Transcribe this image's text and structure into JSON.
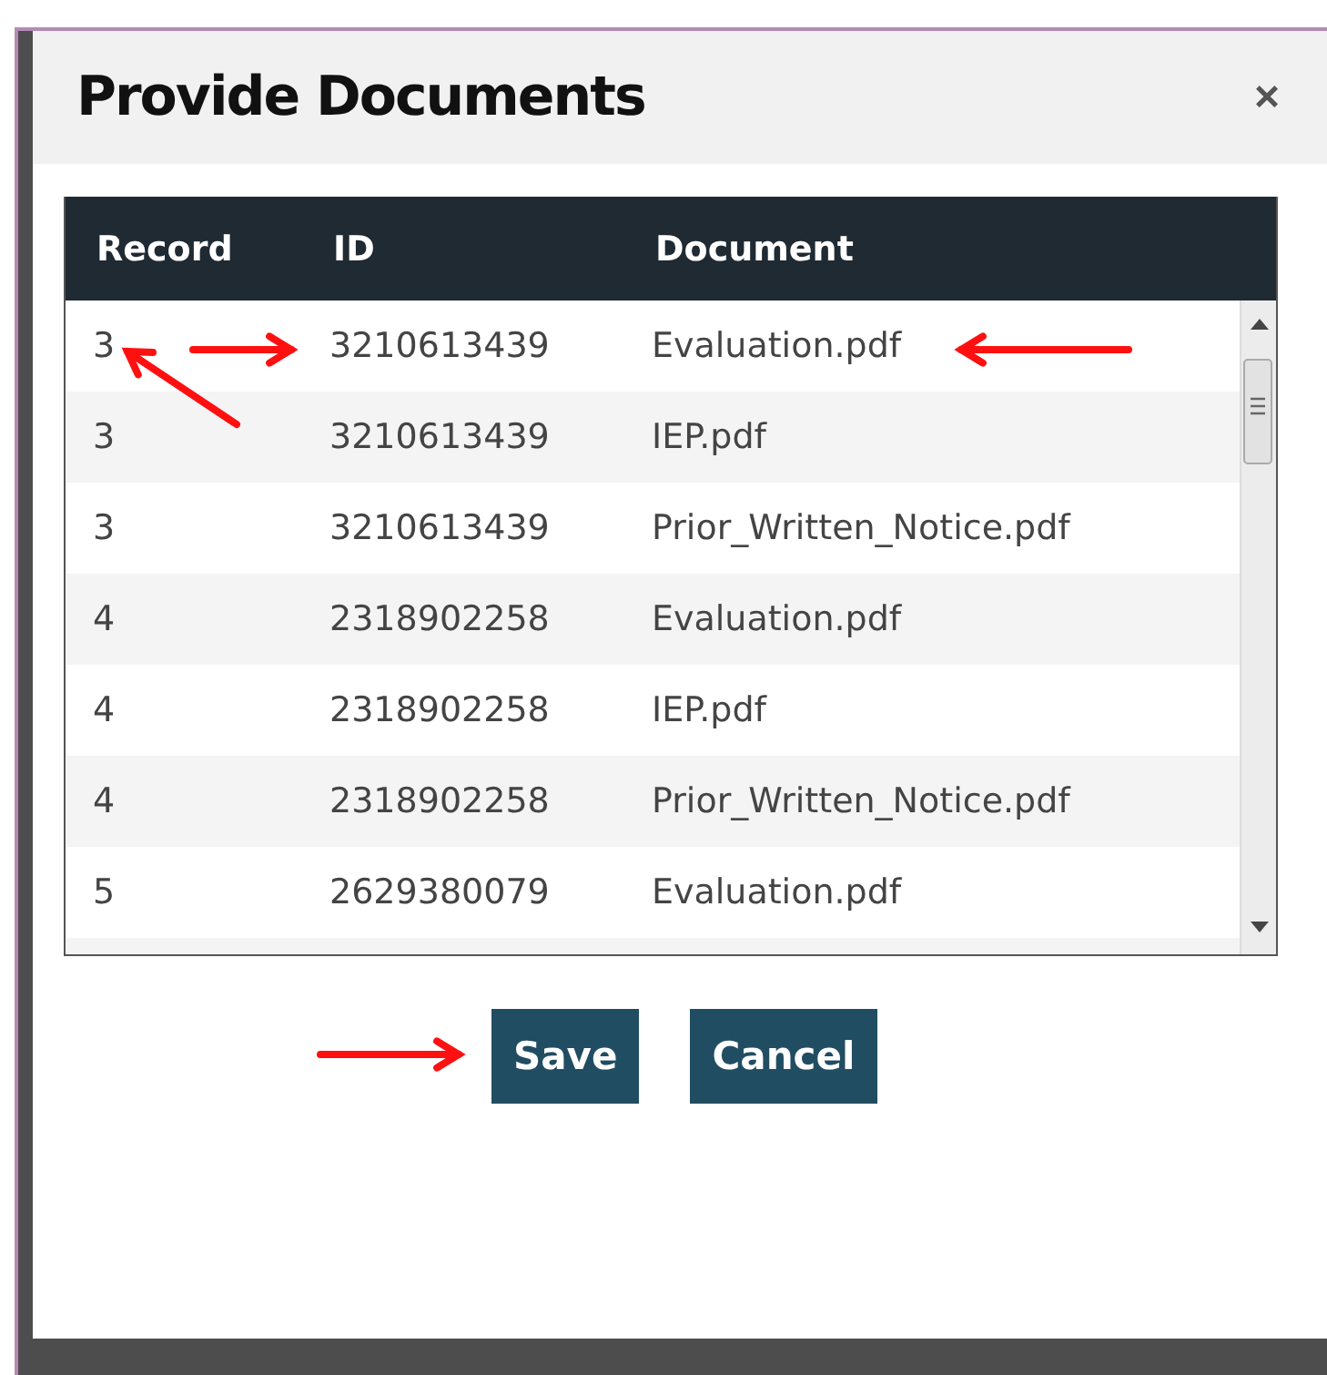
{
  "dialog": {
    "title": "Provide Documents",
    "close": "×"
  },
  "table": {
    "columns": [
      "Record",
      "ID",
      "Document"
    ],
    "rows": [
      {
        "record": "3",
        "id": "3210613439",
        "document": "Evaluation.pdf"
      },
      {
        "record": "3",
        "id": "3210613439",
        "document": "IEP.pdf"
      },
      {
        "record": "3",
        "id": "3210613439",
        "document": "Prior_Written_Notice.pdf"
      },
      {
        "record": "4",
        "id": "2318902258",
        "document": "Evaluation.pdf"
      },
      {
        "record": "4",
        "id": "2318902258",
        "document": "IEP.pdf"
      },
      {
        "record": "4",
        "id": "2318902258",
        "document": "Prior_Written_Notice.pdf"
      },
      {
        "record": "5",
        "id": "2629380079",
        "document": "Evaluation.pdf"
      }
    ]
  },
  "buttons": [
    "Save",
    "Cancel"
  ]
}
